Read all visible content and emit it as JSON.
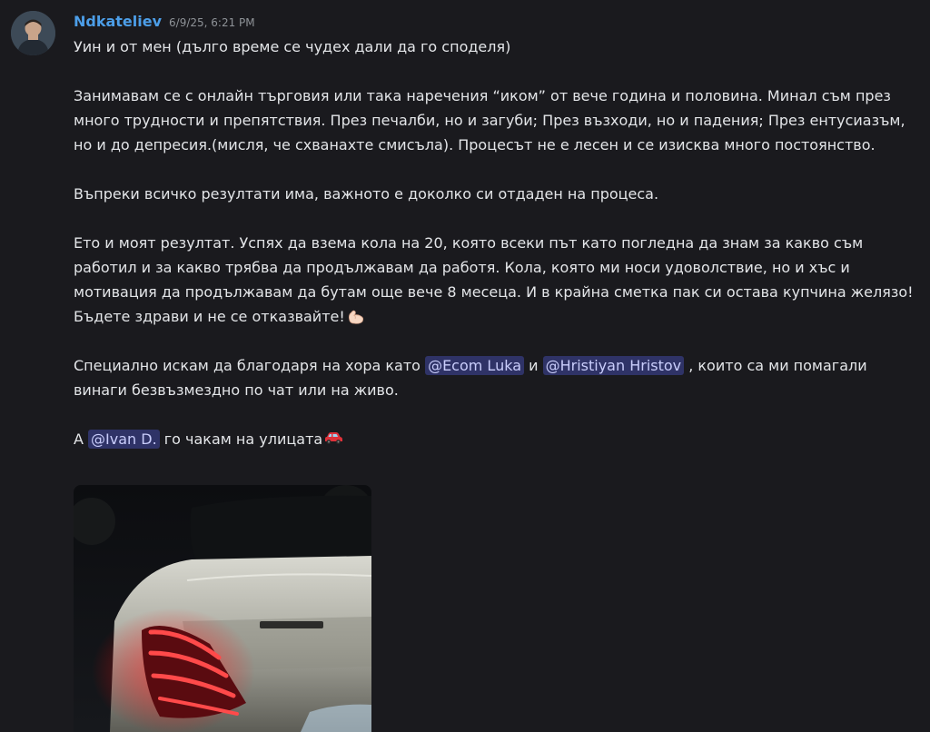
{
  "message": {
    "author": "Ndkateliev",
    "timestamp": "6/9/25, 6:21 PM",
    "line1": "Уин и от мен (дълго време се чудех дали да го споделя)",
    "para1": "Занимавам се с онлайн търговия или така наречения “иком” от  вече година и половина. Минал съм през много трудности и препятствия. През печалби, но и загуби; През възходи, но и падения; През ентусиазъм, но и до депресия.(мисля, че схванахте смисъла). Процесът не е лесен и се изисква много постоянство.",
    "para2": "Въпреки всичко резултати има, важното е доколко си отдаден на процеса.",
    "para3": "Ето и моят резултат. Успях да взема кола на 20, която всеки път като погледна да знам за какво съм работил и за какво трябва да продължавам да работя. Кола, която ми носи удоволствие, но и хъс и мотивация да продължавам да бутам още вече 8 месеца. И в крайна сметка пак си остава купчина желязо! Бъдете здрави и не се отказвайте!",
    "para3_emoji": "flexed-biceps",
    "para4_before": "Специално искам да благодаря на хора като",
    "mention1": "@Ecom Luka",
    "para4_and": "и",
    "mention2": "@Hristiyan Hristov",
    "para4_after": ", които са ми помагали винаги безвъзмездно по чат или на живо.",
    "para5_before": "А",
    "mention3": "@Ivan D.",
    "para5_after": "го чакам на улицата",
    "para5_emoji": "red-car",
    "attachment_icon": "car-photo"
  },
  "colors": {
    "background": "#1a1a1e",
    "username": "#4c9ee8",
    "timestamp": "#8e9297",
    "text": "#e3e5e8",
    "mention_bg": "#3b4280",
    "mention_text": "#c9cdfb"
  }
}
